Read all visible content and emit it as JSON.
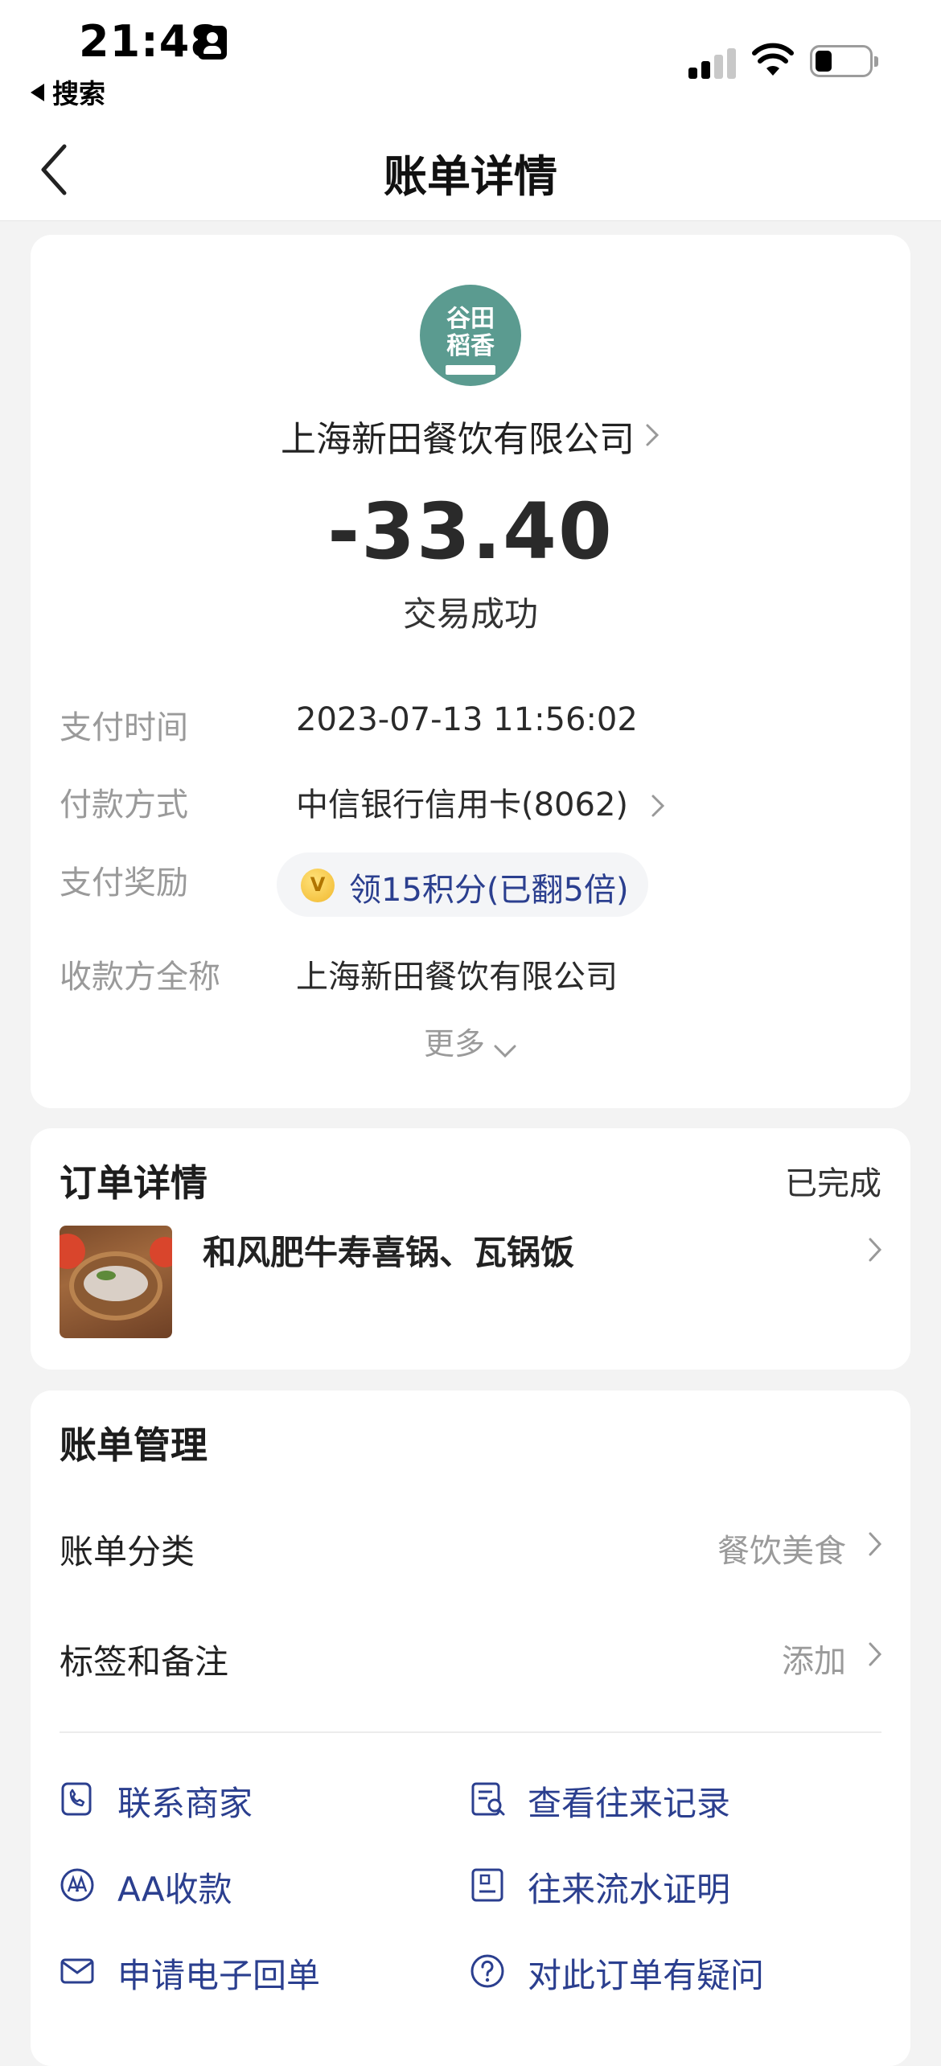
{
  "status_bar": {
    "time": "21:48",
    "back_app": "搜索"
  },
  "nav": {
    "title": "账单详情"
  },
  "transaction": {
    "merchant_name": "上海新田餐饮有限公司",
    "logo_text": "谷田稻香",
    "amount": "-33.40",
    "status": "交易成功",
    "details": [
      {
        "label": "支付时间",
        "value": "2023-07-13 11:56:02"
      },
      {
        "label": "付款方式",
        "value": "中信银行信用卡(8062)"
      },
      {
        "label": "支付奖励",
        "value": "领15积分(已翻5倍)"
      },
      {
        "label": "收款方全称",
        "value": "上海新田餐饮有限公司"
      }
    ],
    "more_label": "更多"
  },
  "order": {
    "title": "订单详情",
    "status": "已完成",
    "item_name": "和风肥牛寿喜锅、瓦锅饭"
  },
  "bill_management": {
    "title": "账单管理",
    "rows": [
      {
        "label": "账单分类",
        "value": "餐饮美食"
      },
      {
        "label": "标签和备注",
        "value": "添加"
      }
    ],
    "actions": [
      {
        "label": "联系商家",
        "icon": "phone-icon"
      },
      {
        "label": "查看往来记录",
        "icon": "record-search-icon"
      },
      {
        "label": "AA收款",
        "icon": "aa-icon"
      },
      {
        "label": "往来流水证明",
        "icon": "certificate-icon"
      },
      {
        "label": "申请电子回单",
        "icon": "mail-icon"
      },
      {
        "label": "对此订单有疑问",
        "icon": "question-icon"
      }
    ]
  },
  "colors": {
    "accent": "#2b3f8f",
    "logo_bg": "#5b9b90",
    "muted": "#9a9a9a"
  }
}
